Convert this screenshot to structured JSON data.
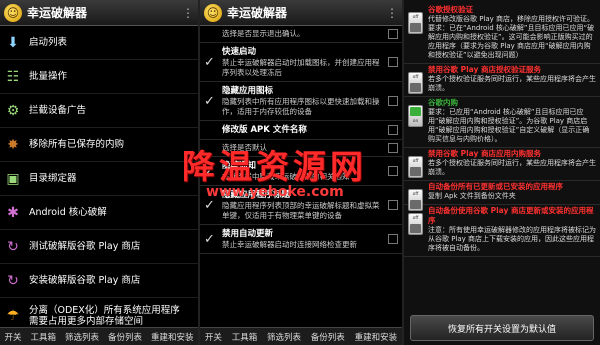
{
  "colors": {
    "accent_red": "#ff3030",
    "accent_green": "#3ab03a"
  },
  "panel1": {
    "title": "幸运破解器",
    "menu_items": [
      {
        "icon": "download-icon",
        "glyph": "⬇",
        "color": "#8fd3ff",
        "label": "启动列表"
      },
      {
        "icon": "list-icon",
        "glyph": "☷",
        "color": "#9ad87a",
        "label": "批量操作"
      },
      {
        "icon": "ad-block-icon",
        "glyph": "⚙",
        "color": "#9ad87a",
        "label": "拦截设备广告"
      },
      {
        "icon": "android-icon",
        "glyph": "✸",
        "color": "#c97a2a",
        "label": "移除所有已保存的内购"
      },
      {
        "icon": "dir-icon",
        "glyph": "▣",
        "color": "#9ad87a",
        "label": "目录绑定器"
      },
      {
        "icon": "android-core-icon",
        "glyph": "✱",
        "color": "#d070d0",
        "label": "Android 核心破解"
      },
      {
        "icon": "play-store-icon",
        "glyph": "↻",
        "color": "#d070d0",
        "label": "测试破解版谷歌 Play 商店"
      },
      {
        "icon": "install-icon",
        "glyph": "↻",
        "color": "#d070d0",
        "label": "安装破解版谷歌 Play 商店"
      },
      {
        "icon": "odex-icon",
        "glyph": "☂",
        "color": "#ffb020",
        "label": "分离（ODEX化）所有系统应用程序",
        "sub": "需要占用更多内部存储空间"
      }
    ],
    "tabs": [
      "开关",
      "工具箱",
      "筛选列表",
      "备份列表",
      "重建和安装"
    ]
  },
  "panel2": {
    "title": "幸运破解器",
    "settings": [
      {
        "title": "",
        "desc": "选择是否显示退出确认。",
        "checked": false
      },
      {
        "title": "快速启动",
        "desc": "禁止幸运破解器启动时加载图标，并创建应用程序列表以处理冻后",
        "checked": true
      },
      {
        "title": "隐藏应用图标",
        "desc": "隐藏列表中所有应用程序图标以更快速加载和操作，适用于内存较低的设备",
        "checked": true
      },
      {
        "title": "修改版 APK 文件名称",
        "desc": "",
        "checked": false
      },
      {
        "title": "",
        "desc": "选择是否默认",
        "checked": false
      },
      {
        "title": "隐藏通知",
        "desc": "在状态栏中隐藏幸运破解器的相关通知",
        "checked": true
      },
      {
        "title": "隐藏应用程序标题",
        "desc": "隐藏应用程序列表顶部的幸运破解标题和虚拟菜单键，仅适用于有物理菜单键的设备",
        "checked": true
      },
      {
        "title": "禁用自动更新",
        "desc": "禁止幸运破解器启动时连接网络检查更新",
        "checked": true
      }
    ],
    "tabs": [
      "开关",
      "工具箱",
      "筛选列表",
      "备份列表",
      "重建和安装"
    ]
  },
  "watermark": {
    "main": "降温资源网",
    "url": "www.yeboke.com"
  },
  "panel3": {
    "toggles": [
      {
        "state": "off",
        "title": "谷歌授权验证",
        "title_color": "#ff3030",
        "desc": "代替修改版谷歌 Play 商店，移除应用授权许可验证。要求：已在“Android 核心破解”且目标应用已应用“破解应用内购和授权验证”。这可能会影响正版购买过的应用程序（要求为谷歌 Play 商店应用“破解应用内购和授权验证”以避免出现问题）"
      },
      {
        "state": "off",
        "title": "禁用谷歌 Play 商店授权验证服务",
        "title_color": "#ff3030",
        "desc": "若多个授权验证服务同时运行，某些应用程序将会产生崩溃。"
      },
      {
        "state": "on",
        "title": "谷歌内购",
        "title_color": "#3ab03a",
        "desc": "要求：已应用“Android 核心破解”且目标应用已应用“破解应用内购和授权验证”。为谷歌 Play 商店启用“破解应用内购和授权验证”自定义破解（显示正确购买信息与内购价格）。"
      },
      {
        "state": "off",
        "title": "禁用谷歌 Play 商店应用内购服务",
        "title_color": "#ff3030",
        "desc": "若多个授权验证服务同时运行，某些应用程序将会产生崩溃。"
      },
      {
        "state": "off",
        "title": "自动备份所有已更新或已安装的应用程序",
        "title_color": "#ff3030",
        "desc": "复制 Apk 文件到备份文件夹"
      },
      {
        "state": "off",
        "title": "自动备份使用谷歌 Play 商店更新或安装的应用程序",
        "title_color": "#ff3030",
        "desc": "注意：所有使用幸运破解器修改的应用程序将被标记为从谷歌 Play 商店上下载安装的应用，因此这些应用程序将被自动备份。"
      }
    ],
    "reset_label": "恢复所有开关设置为默认值"
  }
}
